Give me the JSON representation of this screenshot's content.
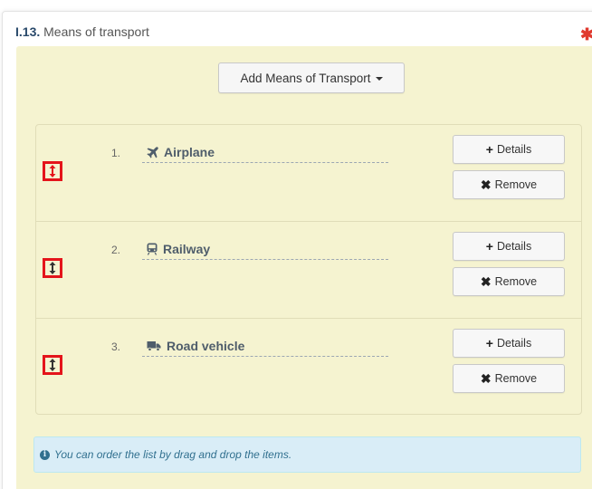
{
  "section": {
    "code": "I.13.",
    "title": "Means of transport",
    "required_symbol": "✱"
  },
  "add_button": {
    "label": "Add Means of Transport"
  },
  "items": [
    {
      "number": "1.",
      "icon": "airplane-icon",
      "name": "Airplane",
      "details_label": "Details",
      "remove_label": "Remove"
    },
    {
      "number": "2.",
      "icon": "train-icon",
      "name": "Railway",
      "details_label": "Details",
      "remove_label": "Remove"
    },
    {
      "number": "3.",
      "icon": "truck-icon",
      "name": "Road vehicle",
      "details_label": "Details",
      "remove_label": "Remove"
    }
  ],
  "info": {
    "text": "You can order the list by drag and drop the items."
  },
  "colors": {
    "panel_bg": "#f5f3d0",
    "highlight_border": "#e4141b",
    "info_bg": "#d9edf7",
    "info_text": "#31708f",
    "required": "#e03a2f",
    "item_name": "#4f5d6b"
  }
}
